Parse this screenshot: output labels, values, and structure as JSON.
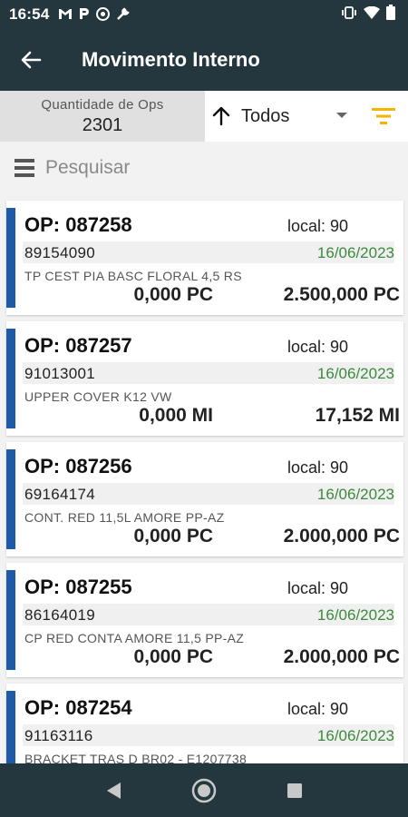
{
  "status": {
    "time": "16:54",
    "left_icons": [
      "gmail-icon",
      "parking-icon",
      "chrome-icon",
      "wrench-icon"
    ],
    "right_icons": [
      "vibrate-icon",
      "wifi-icon",
      "battery-icon"
    ]
  },
  "appbar": {
    "title": "Movimento Interno"
  },
  "filter": {
    "qty_label": "Quantidade de Ops",
    "qty_value": "2301",
    "sort_label": "Todos"
  },
  "search": {
    "placeholder": "Pesquisar"
  },
  "colors": {
    "primary": "#24373f",
    "accent_bar": "#1e5aa8",
    "date_green": "#3c8a3c",
    "filter_icon": "#f4b400"
  },
  "cards": [
    {
      "op": "OP: 087258",
      "local": "local: 90",
      "code": "89154090",
      "date": "16/06/2023",
      "desc": "TP CEST PIA BASC FLORAL 4,5 RS",
      "qty1": "0,000 PC",
      "qty2": "2.500,000 PC"
    },
    {
      "op": "OP: 087257",
      "local": "local: 90",
      "code": "91013001",
      "date": "16/06/2023",
      "desc": "UPPER COVER K12 VW",
      "qty1": "0,000 MI",
      "qty2": "17,152 MI"
    },
    {
      "op": "OP: 087256",
      "local": "local: 90",
      "code": "69164174",
      "date": "16/06/2023",
      "desc": "CONT. RED 11,5L AMORE PP-AZ",
      "qty1": "0,000 PC",
      "qty2": "2.000,000 PC"
    },
    {
      "op": "OP: 087255",
      "local": "local: 90",
      "code": "86164019",
      "date": "16/06/2023",
      "desc": "CP RED CONTA AMORE 11,5 PP-AZ",
      "qty1": "0,000 PC",
      "qty2": "2.000,000 PC"
    },
    {
      "op": "OP: 087254",
      "local": "local: 90",
      "code": "91163116",
      "date": "16/06/2023",
      "desc": "BRACKET TRAS D BR02 - E1207738",
      "qty1": "",
      "qty2": ""
    }
  ]
}
